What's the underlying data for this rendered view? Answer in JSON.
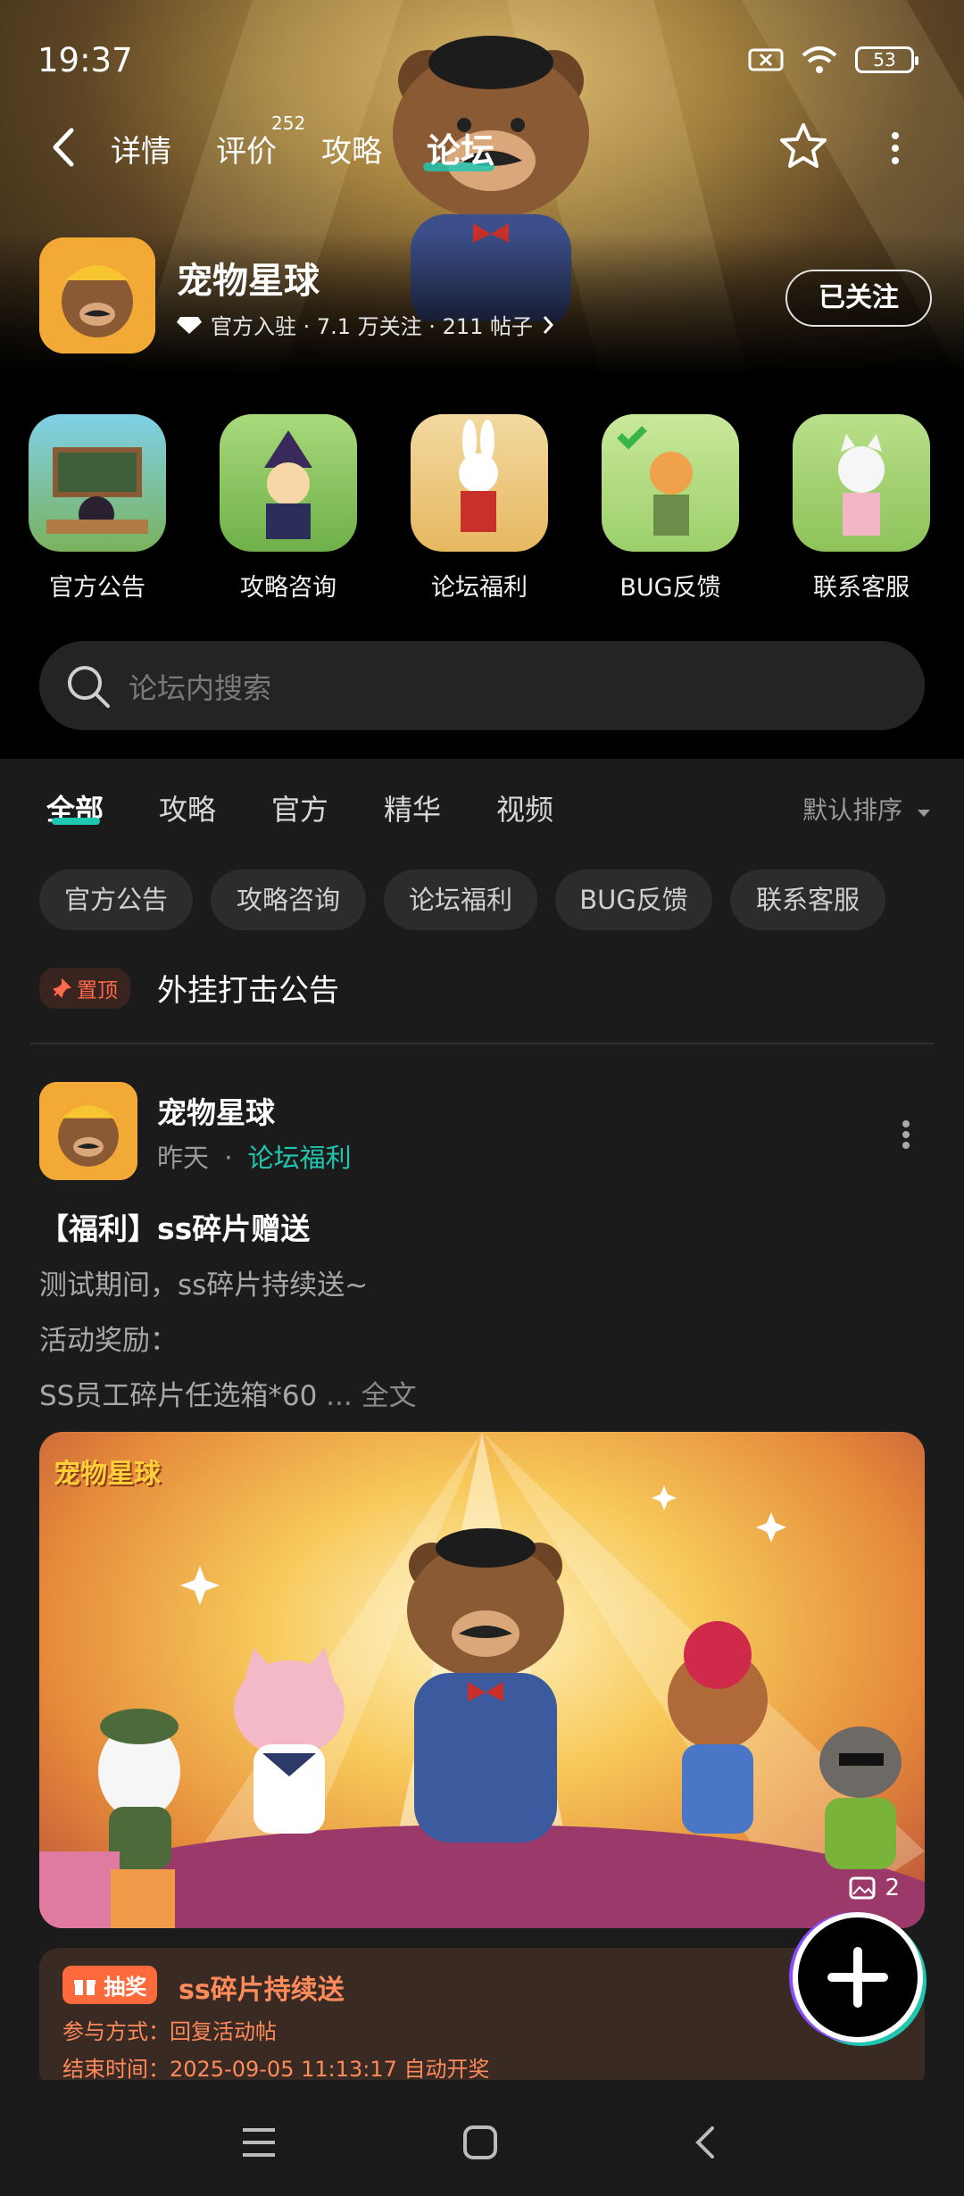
{
  "status_bar": {
    "time": "19:37",
    "battery": "53"
  },
  "nav": {
    "tabs": [
      {
        "label": "详情"
      },
      {
        "label": "评价",
        "badge": "252"
      },
      {
        "label": "攻略"
      },
      {
        "label": "论坛"
      }
    ],
    "active_tab": "论坛"
  },
  "forum": {
    "name": "宠物星球",
    "meta": "官方入驻 · 7.1 万关注 · 211 帖子",
    "follow_label": "已关注"
  },
  "categories": [
    {
      "label": "官方公告"
    },
    {
      "label": "攻略咨询"
    },
    {
      "label": "论坛福利"
    },
    {
      "label": "BUG反馈"
    },
    {
      "label": "联系客服"
    }
  ],
  "search": {
    "placeholder": "论坛内搜索"
  },
  "filter": {
    "tabs": [
      "全部",
      "攻略",
      "官方",
      "精华",
      "视频"
    ],
    "sort_label": "默认排序",
    "chips": [
      "官方公告",
      "攻略咨询",
      "论坛福利",
      "BUG反馈",
      "联系客服"
    ]
  },
  "pinned": {
    "badge": "置顶",
    "title": "外挂打击公告"
  },
  "post": {
    "author": "宠物星球",
    "time": "昨天",
    "section": "论坛福利",
    "title": "【福利】ss碎片赠送",
    "lines": [
      "测试期间，ss碎片持续送~",
      "活动奖励：",
      "SS员工碎片任选箱*60"
    ],
    "ellipsis": "...",
    "full_text": "全文",
    "image_count": "2",
    "image_logo": "宠物星球"
  },
  "lottery": {
    "badge": "抽奖",
    "title": "ss碎片持续送",
    "method": "参与方式：回复活动帖",
    "end_time": "结束时间：2025-09-05 11:13:17 自动开奖"
  },
  "colors": {
    "accent": "#1fc7b0",
    "pin": "#ff6a4d",
    "lottery": "#ff8a5a"
  }
}
